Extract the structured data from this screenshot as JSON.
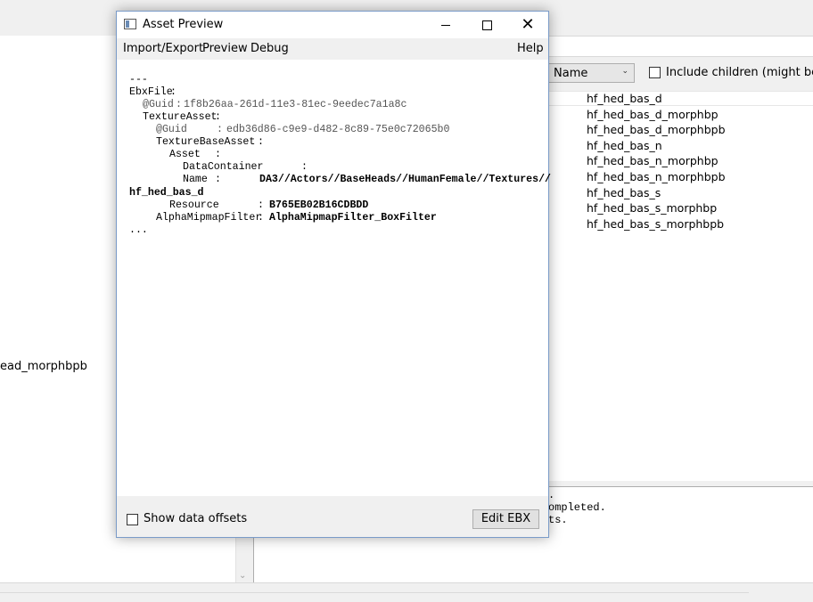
{
  "background": {
    "left_list": {
      "item": "ead_morphbpb"
    },
    "toolbar": {
      "sort_select": "Name",
      "include_children_label": "Include children (might be slow"
    },
    "asset_list": [
      "hf_hed_bas_d",
      "hf_hed_bas_d_morphbp",
      "hf_hed_bas_d_morphbpb",
      "hf_hed_bas_n",
      "hf_hed_bas_n_morphbp",
      "hf_hed_bas_n_morphbpb",
      "hf_hed_bas_s",
      "hf_hed_bas_s_morphbp",
      "hf_hed_bas_s_morphbpb"
    ],
    "log_lines": [
      ".",
      "ompleted.",
      "ts."
    ]
  },
  "dialog": {
    "title": "Asset Preview",
    "menu": [
      "Import/Export",
      "Preview",
      "Debug",
      "Help"
    ],
    "preview": {
      "start": "---",
      "ebx_file": "EbxFile",
      "guid_key": "@Guid",
      "guid_value": "1f8b26aa-261d-11e3-81ec-9eedec7a1a8c",
      "texture_asset": "TextureAsset",
      "ta_guid_key": "@Guid",
      "ta_guid_value": "edb36d86-c9e9-d482-8c89-75e0c72065b0",
      "texture_base_asset": "TextureBaseAsset",
      "asset": "Asset",
      "data_container": "DataContainer",
      "name_key": "Name",
      "name_value": "DA3//Actors//BaseHeads//HumanFemale//Textures//",
      "name_value_cont": "hf_hed_bas_d",
      "resource_key": "Resource",
      "resource_value": "B765EB02B16CDBDD",
      "alpha_key": "AlphaMipmapFilter",
      "alpha_value": "AlphaMipmapFilter_BoxFilter",
      "end": "..."
    },
    "footer": {
      "show_offsets_label": "Show data offsets",
      "edit_button": "Edit EBX"
    }
  }
}
